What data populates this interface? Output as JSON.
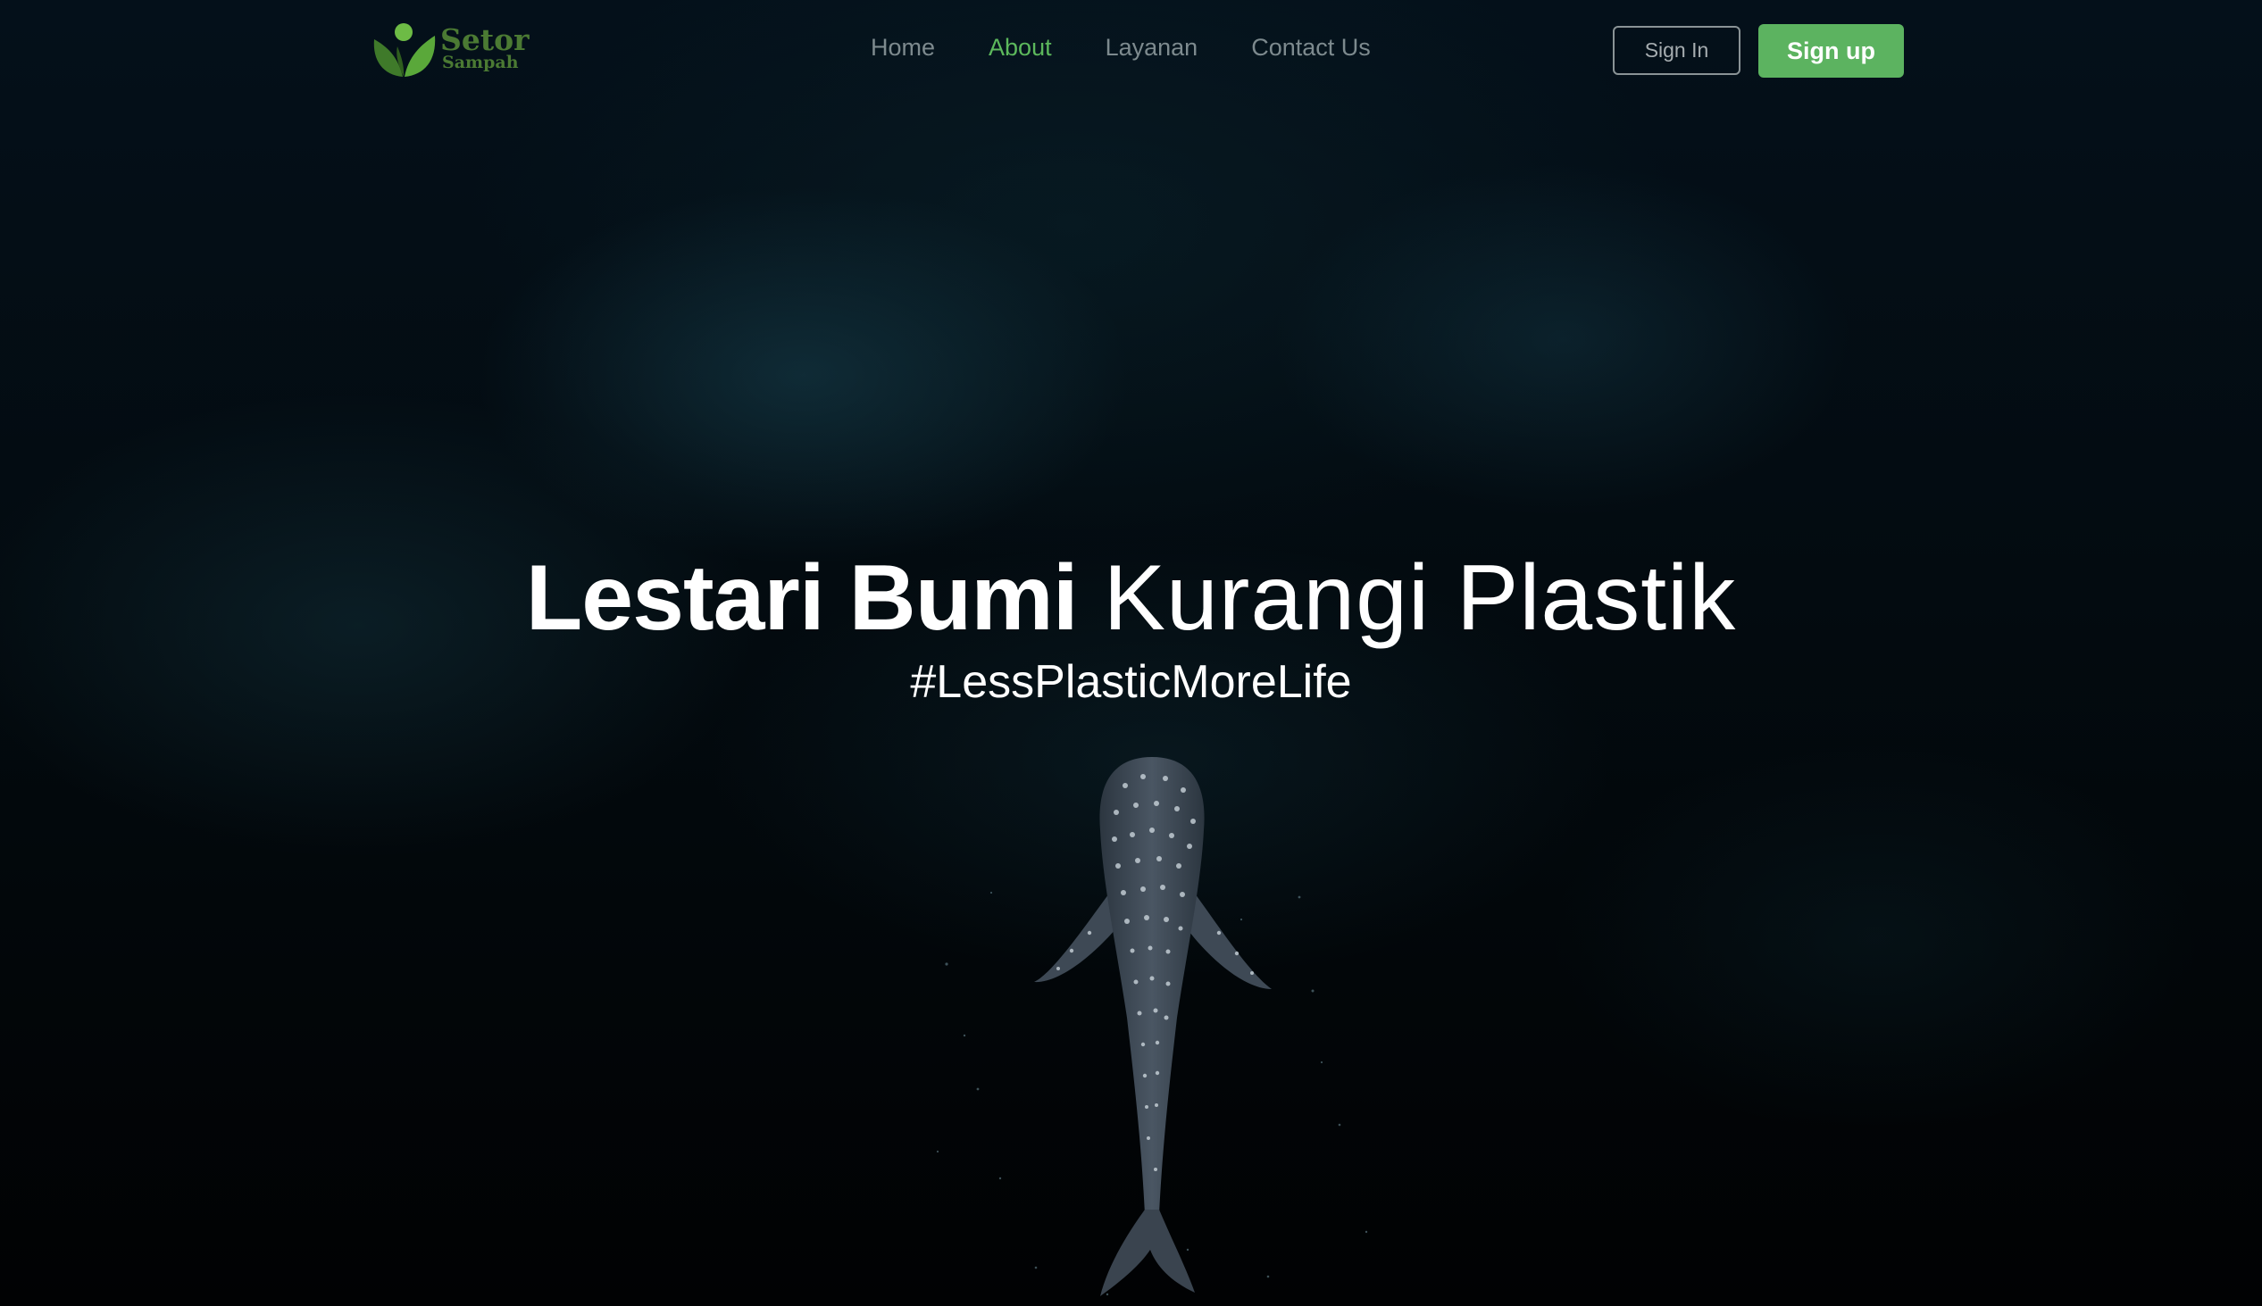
{
  "brand": {
    "name_line1": "Setor",
    "name_line2": "Sampah"
  },
  "nav": {
    "items": [
      {
        "label": "Home",
        "active": false
      },
      {
        "label": "About",
        "active": true
      },
      {
        "label": "Layanan",
        "active": false
      },
      {
        "label": "Contact Us",
        "active": false
      }
    ]
  },
  "auth": {
    "signin_label": "Sign In",
    "signup_label": "Sign up"
  },
  "hero": {
    "headline_bold": "Lestari Bumi",
    "headline_light": "Kurangi Plastik",
    "hashtag": "#LessPlasticMoreLife",
    "background_image": "whale-shark-underwater"
  },
  "colors": {
    "accent": "#5cb360",
    "nav_active": "#5cb85c",
    "nav_inactive": "#7d8a8e",
    "logo": "#4b7a33",
    "background": "#020506"
  }
}
